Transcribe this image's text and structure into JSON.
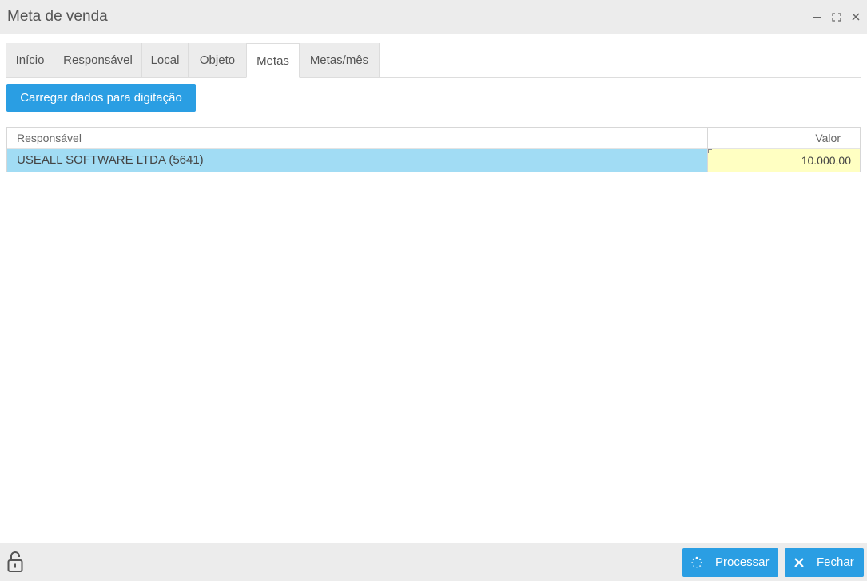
{
  "window": {
    "title": "Meta de venda"
  },
  "tabs": [
    {
      "label": "Início"
    },
    {
      "label": "Responsável"
    },
    {
      "label": "Local"
    },
    {
      "label": "Objeto"
    },
    {
      "label": "Metas",
      "active": true
    },
    {
      "label": "Metas/mês"
    }
  ],
  "actions": {
    "load_label": "Carregar dados para digitação"
  },
  "grid": {
    "columns": [
      "Responsável",
      "Valor"
    ],
    "rows": [
      {
        "responsavel": "USEALL SOFTWARE LTDA (5641)",
        "valor": "10.000,00"
      }
    ]
  },
  "footer": {
    "process_label": "Processar",
    "close_label": "Fechar"
  },
  "icons": {
    "minimize": "minimize-icon",
    "maximize": "maximize-icon",
    "close": "close-icon",
    "lock": "unlock-icon",
    "spinner": "spinner-icon",
    "x": "x-icon"
  },
  "colors": {
    "accent": "#2a9ee3",
    "selected_row": "#a1dcf4",
    "edited_cell": "#ffffc2",
    "chrome": "#ececec"
  }
}
